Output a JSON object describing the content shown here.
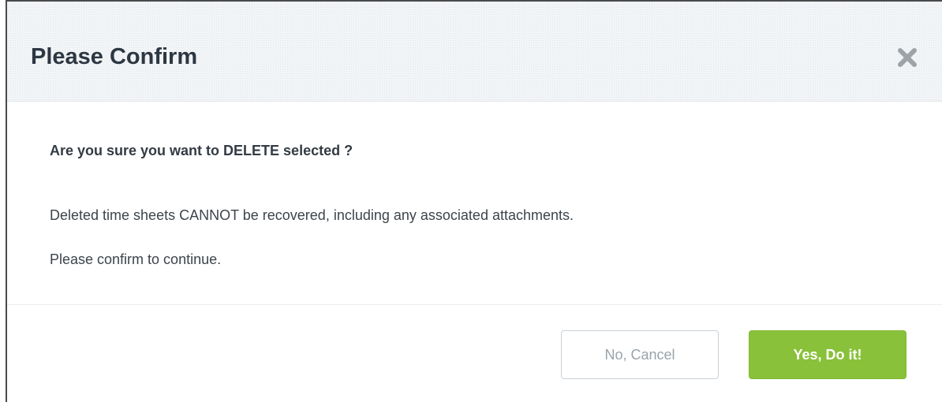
{
  "dialog": {
    "title": "Please Confirm",
    "close_icon": "close-icon",
    "question": "Are you sure you want to DELETE selected ?",
    "message_lines": [
      "Deleted time sheets CANNOT be recovered, including any associated attachments.",
      "Please confirm to continue."
    ],
    "buttons": {
      "cancel_label": "No, Cancel",
      "confirm_label": "Yes, Do it!"
    }
  },
  "colors": {
    "confirm_button": "#89c13a",
    "header_background": "#f2f5f7",
    "title_text": "#2c3742",
    "cancel_text": "#9aa3ab"
  }
}
